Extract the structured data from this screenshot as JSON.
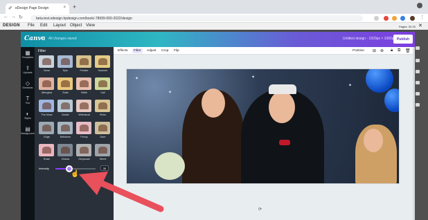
{
  "browser": {
    "tab_title": "eDesign Page Design",
    "url": "beta.test.edesign.hpdesign.com/book/-78699-000-2022/design",
    "new_tab": "+"
  },
  "app": {
    "logo": "DESIGN",
    "menu": [
      "File",
      "Edit",
      "Layout",
      "Object",
      "View"
    ],
    "pages_label": "Pages: 32-25"
  },
  "canva": {
    "logo": "Canva",
    "undo": "↶",
    "save_status": "All changes saved",
    "doc_title": "Untitled design - 1920px × 1080px",
    "publish": "Publish",
    "sidebar": [
      {
        "icon": "▦",
        "label": "Templates"
      },
      {
        "icon": "⇪",
        "label": "Uploads"
      },
      {
        "icon": "◇",
        "label": "Elements"
      },
      {
        "icon": "T",
        "label": "Text"
      },
      {
        "icon": "◐",
        "label": "Styles"
      },
      {
        "icon": "▤",
        "label": "Background"
      }
    ],
    "panel_title": "Filter",
    "filters": [
      {
        "name": "None",
        "color": "#c9d3dd"
      },
      {
        "name": "Epic",
        "color": "#a7b9d4"
      },
      {
        "name": "Festive",
        "color": "#d7c38f"
      },
      {
        "name": "Summer",
        "color": "#e4cc87"
      },
      {
        "name": "Afterglow",
        "color": "#dfb3a3"
      },
      {
        "name": "Solar",
        "color": "#e8c77f"
      },
      {
        "name": "Selfie",
        "color": "#e9c1b1"
      },
      {
        "name": "Cali",
        "color": "#cfd89a"
      },
      {
        "name": "The blues",
        "color": "#9fb6e1"
      },
      {
        "name": "Nordic",
        "color": "#b8c9d6"
      },
      {
        "name": "Whimsical",
        "color": "#e5c9c2"
      },
      {
        "name": "Retro",
        "color": "#d8c596"
      },
      {
        "name": "Edge",
        "color": "#9aa9b3"
      },
      {
        "name": "Bellstone",
        "color": "#a6b5c1"
      },
      {
        "name": "Peony",
        "color": "#e6bdc7"
      },
      {
        "name": "Dare",
        "color": "#cdbe9e"
      },
      {
        "name": "Rosie",
        "color": "#e8b7c0"
      },
      {
        "name": "Drama",
        "color": "#7d8894"
      },
      {
        "name": "Greyscale",
        "color": "#b1b1b1"
      },
      {
        "name": "Street",
        "color": "#9ea4a9"
      }
    ],
    "intensity_label": "Intensity",
    "intensity_value": "30",
    "intensity_fraction": 0.3,
    "toolbar": {
      "effects": "Effects",
      "filter": "Filter",
      "adjust": "Adjust",
      "crop": "Crop",
      "flip": "Flip",
      "position": "Position"
    },
    "rotate_icon": "⟳"
  },
  "colors": {
    "accent": "#8b3dff",
    "arrow": "#e8505b"
  }
}
